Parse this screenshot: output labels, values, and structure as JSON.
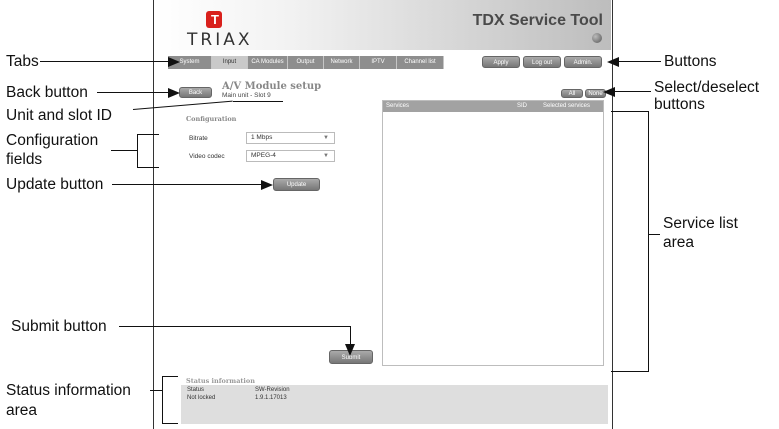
{
  "header": {
    "brand": "TRIAX",
    "brand_mark": "T",
    "app_title": "TDX Service Tool"
  },
  "tabs": [
    "System",
    "Input",
    "CA Modules",
    "Output",
    "Network",
    "IPTV",
    "Channel list"
  ],
  "active_tab": "Input",
  "top_buttons": [
    "Apply",
    "Log out",
    "Admin."
  ],
  "page": {
    "back_label": "Back",
    "title": "A/V Module setup",
    "unit_slot": "Main unit - Slot 9"
  },
  "configuration": {
    "section_title": "Configuration",
    "fields": [
      {
        "label": "Bitrate",
        "value": "1 Mbps"
      },
      {
        "label": "Video codec",
        "value": "MPEG-4"
      }
    ],
    "update_label": "Update"
  },
  "services": {
    "select_all": "All",
    "select_none": "None",
    "columns": [
      "Services",
      "SID",
      "Selected services"
    ]
  },
  "submit_label": "Submit",
  "status": {
    "section_title": "Status information",
    "headers": [
      "Status",
      "SW-Revision"
    ],
    "values": [
      "Not locked",
      "1.9.1.17013"
    ]
  },
  "callouts": {
    "tabs": "Tabs",
    "back_button": "Back button",
    "unit_slot": "Unit and slot ID",
    "config_fields_1": "Configuration",
    "config_fields_2": "fields",
    "update_button": "Update button",
    "submit_button": "Submit button",
    "status_area_1": "Status information",
    "status_area_2": "area",
    "buttons": "Buttons",
    "select_deselect_1": "Select/deselect",
    "select_deselect_2": "buttons",
    "service_list_1": "Service list",
    "service_list_2": "area"
  }
}
